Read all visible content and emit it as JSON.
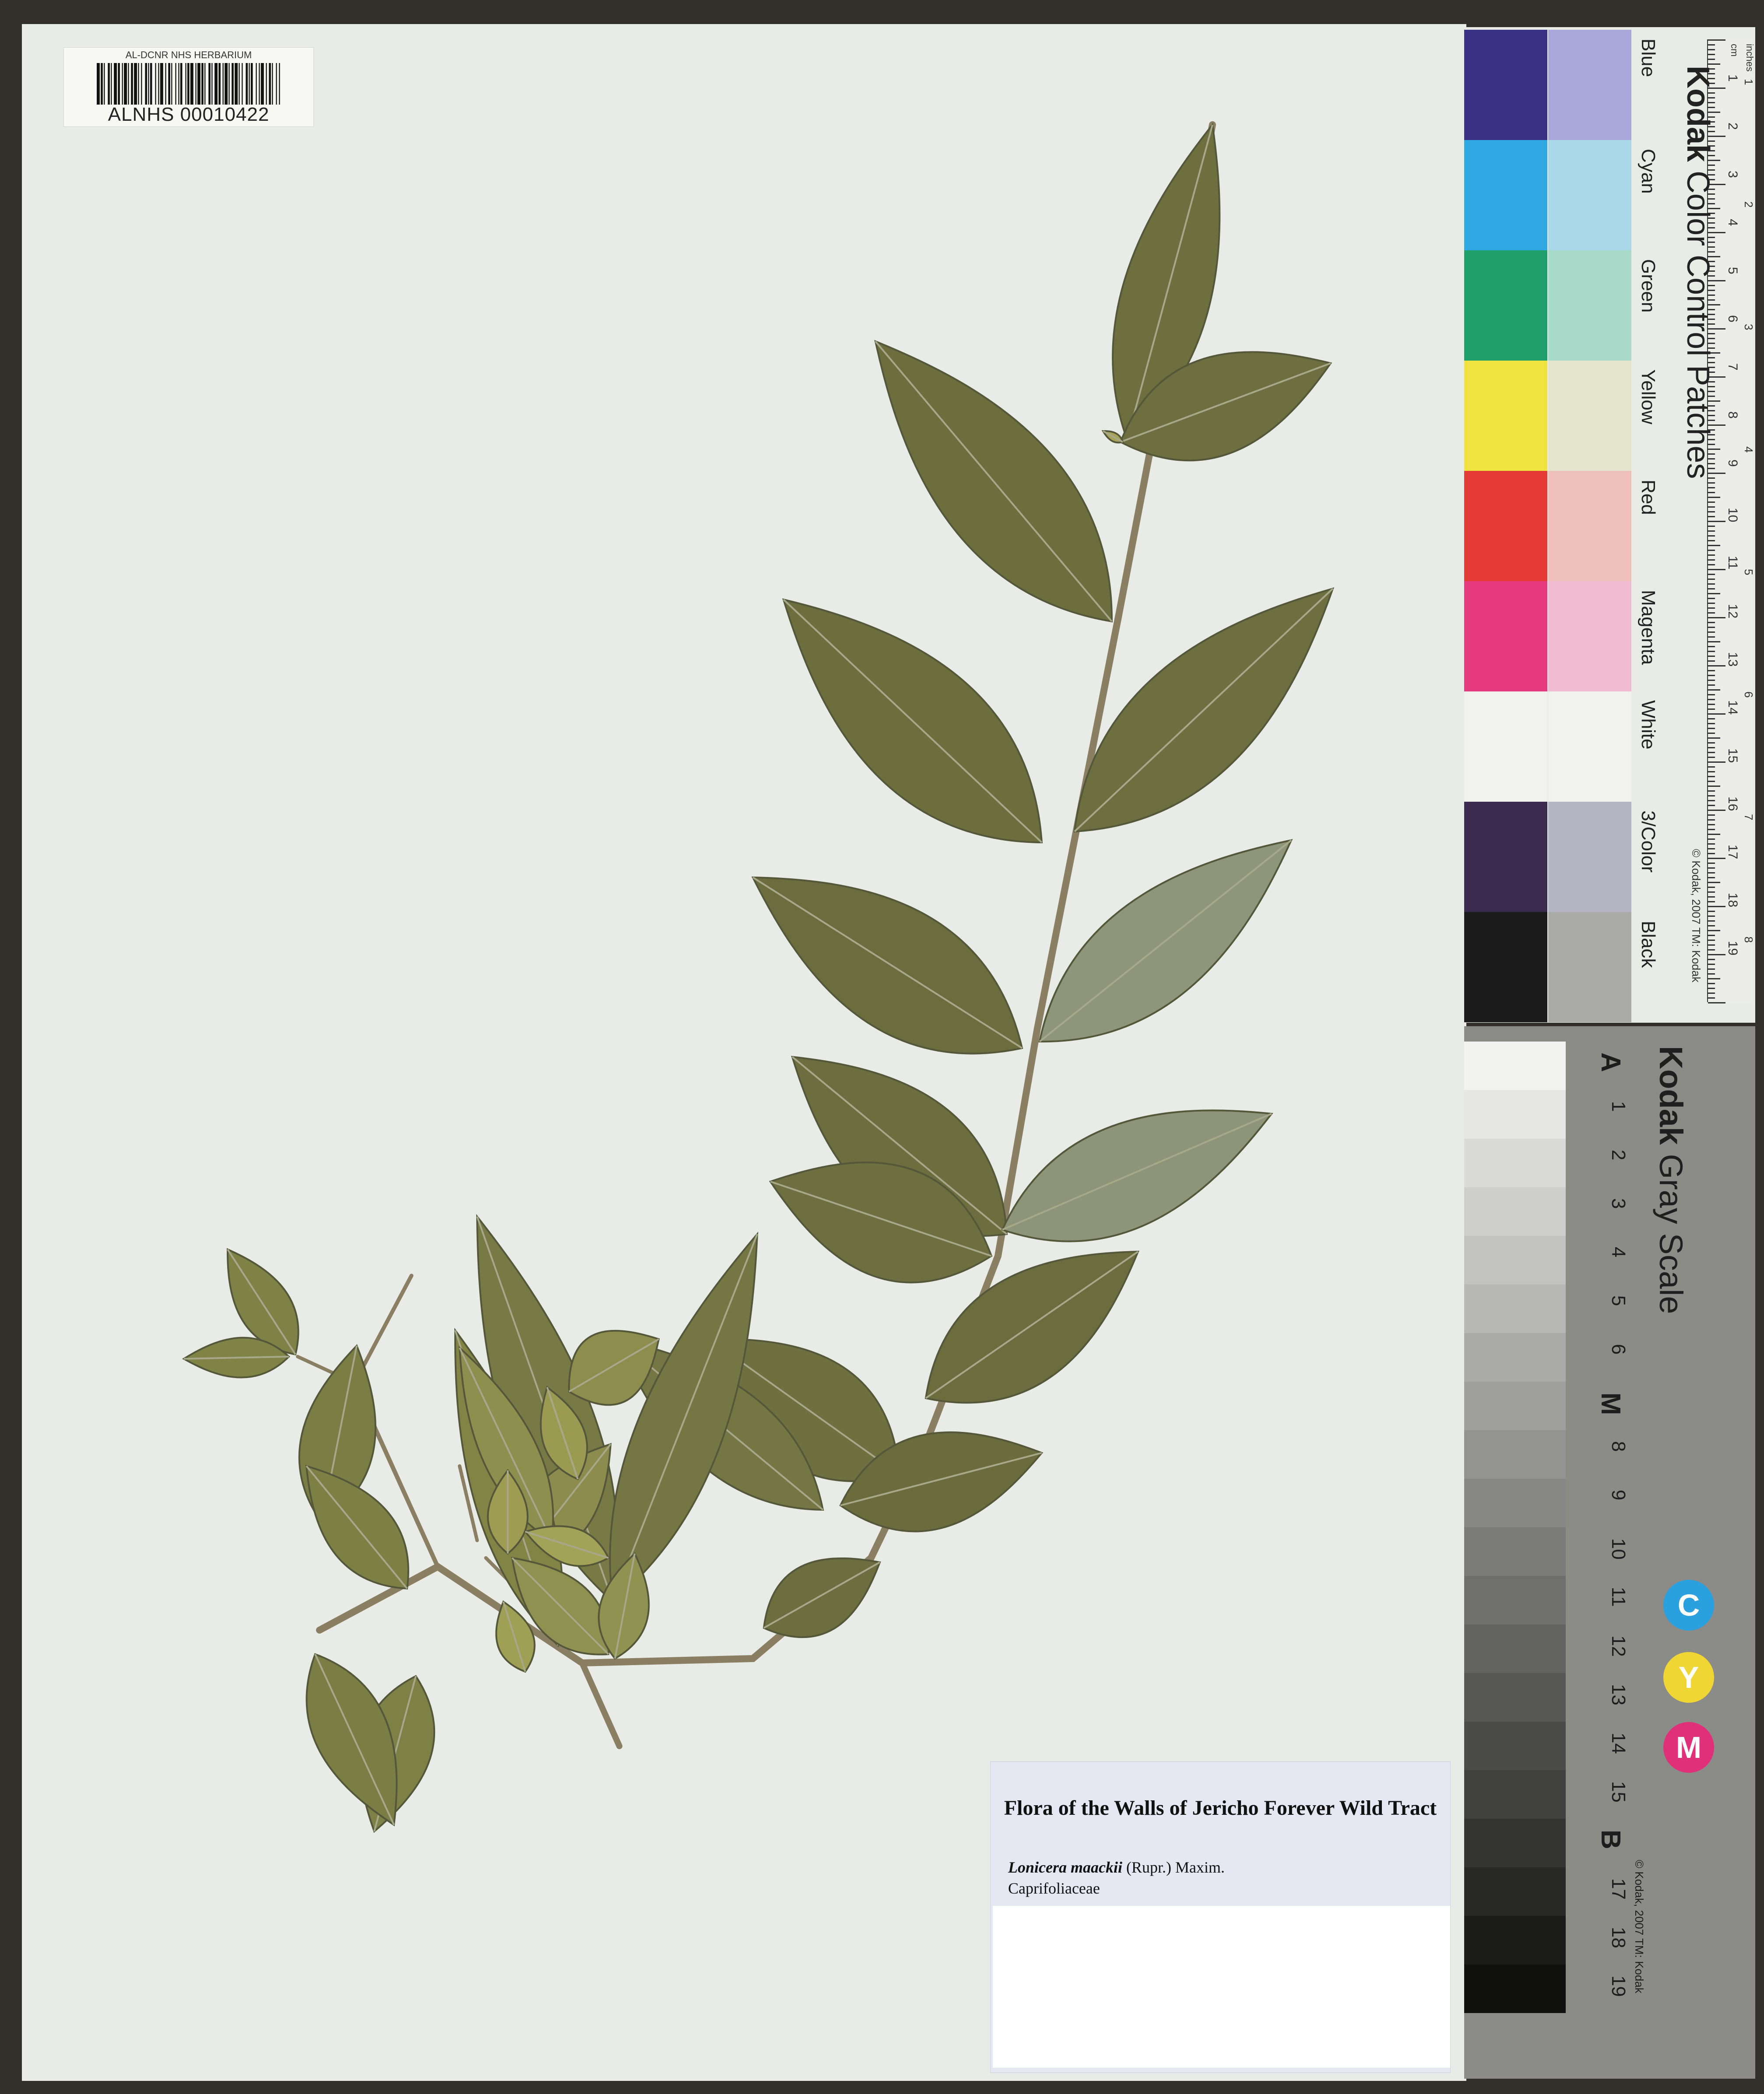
{
  "barcode": {
    "institution": "AL-DCNR NHS HERBARIUM",
    "number": "ALNHS 00010422"
  },
  "label": {
    "title": "Flora of the Walls of Jericho Forever Wild Tract",
    "species_name": "Lonicera maackii",
    "species_author": "(Rupr.) Maxim.",
    "family": "Caprifoliaceae"
  },
  "color_card": {
    "brand_bold": "Kodak",
    "brand_rest": "Color Control Patches",
    "patches": [
      {
        "name": "Blue",
        "dark": "#3a3085",
        "light": "#a8a8da"
      },
      {
        "name": "Cyan",
        "dark": "#2fa8e3",
        "light": "#a9d8e8"
      },
      {
        "name": "Green",
        "dark": "#1fa06a",
        "light": "#a9d9c9"
      },
      {
        "name": "Yellow",
        "dark": "#f0e33f",
        "light": "#e3e6cc"
      },
      {
        "name": "Red",
        "dark": "#e53a36",
        "light": "#efc1bb"
      },
      {
        "name": "Magenta",
        "dark": "#e63a80",
        "light": "#f0bcd2"
      },
      {
        "name": "White",
        "dark": "#f1f1ee",
        "light": "#f1f1ee"
      },
      {
        "name": "3/Color",
        "dark": "#3a2a4d",
        "light": "#b5b4c3"
      },
      {
        "name": "Black",
        "dark": "#1b1b1b",
        "light": "#aaaaa8"
      }
    ],
    "ruler_unit_cm": "cm",
    "ruler_unit_in": "inches",
    "cm_numbers": [
      "1",
      "2",
      "3",
      "4",
      "5",
      "6",
      "7",
      "8",
      "9",
      "10",
      "11",
      "12",
      "13",
      "14",
      "15",
      "16",
      "17",
      "18",
      "19"
    ],
    "in_numbers": [
      "1",
      "2",
      "3",
      "4",
      "5",
      "6",
      "7",
      "8"
    ],
    "copyright": "© Kodak, 2007 TM: Kodak"
  },
  "gray_scale": {
    "brand_bold": "Kodak",
    "brand_rest": "Gray Scale",
    "steps": [
      "A",
      "1",
      "2",
      "3",
      "4",
      "5",
      "6",
      "M",
      "8",
      "9",
      "10",
      "11",
      "12",
      "13",
      "14",
      "15",
      "B",
      "17",
      "18",
      "19"
    ],
    "cym": [
      "C",
      "Y",
      "M"
    ],
    "cym_colors": [
      "#2aa0df",
      "#f0d634",
      "#e0307a"
    ],
    "copyright": "© Kodak, 2007 TM: Kodak"
  }
}
